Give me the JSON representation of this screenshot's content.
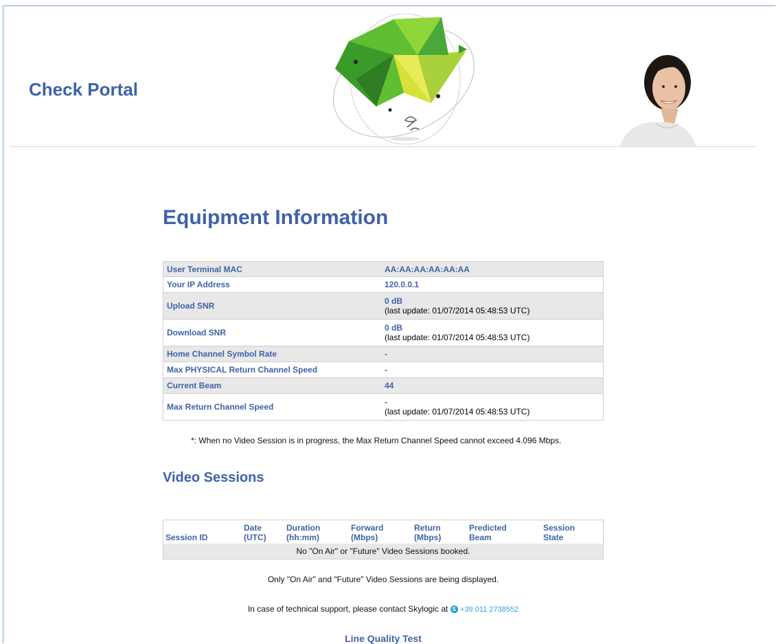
{
  "header": {
    "brand": "Check Portal",
    "logo_icon": "satellite-sphere-logo",
    "photo": "smiling-woman-photo"
  },
  "equipment": {
    "title": "Equipment Information",
    "rows": [
      {
        "label": "User Terminal MAC",
        "value": "AA:AA:AA:AA:AA:AA",
        "note": ""
      },
      {
        "label": "Your IP Address",
        "value": "120.0.0.1",
        "note": ""
      },
      {
        "label": "Upload SNR",
        "value": "0 dB",
        "note": "(last update: 01/07/2014 05:48:53 UTC)"
      },
      {
        "label": "Download SNR",
        "value": "0 dB",
        "note": "(last update: 01/07/2014 05:48:53 UTC)"
      },
      {
        "label": "Home Channel Symbol Rate",
        "value": "-",
        "note": ""
      },
      {
        "label": "Max PHYSICAL Return Channel Speed",
        "value": "-",
        "note": ""
      },
      {
        "label": "Current Beam",
        "value": "44",
        "note": ""
      },
      {
        "label": "Max Return Channel Speed",
        "value": "-",
        "note": "(last update: 01/07/2014 05:48:53 UTC)"
      }
    ],
    "footnote": "*: When no Video Session is in progress, the Max Return Channel Speed cannot exceed 4.096 Mbps."
  },
  "video": {
    "title": "Video Sessions",
    "columns": [
      {
        "line1": "",
        "line2": "Session ID"
      },
      {
        "line1": "Date",
        "line2": "(UTC)"
      },
      {
        "line1": "Duration",
        "line2": "(hh:mm)"
      },
      {
        "line1": "Forward",
        "line2": "(Mbps)"
      },
      {
        "line1": "Return",
        "line2": "(Mbps)"
      },
      {
        "line1": "Predicted",
        "line2": "Beam"
      },
      {
        "line1": "Session",
        "line2": "State"
      }
    ],
    "empty_message": "No \"On Air\" or \"Future\" Video Sessions booked.",
    "display_note": "Only \"On Air\" and \"Future\" Video Sessions are being displayed."
  },
  "support": {
    "text": "In case of technical support, please contact Skylogic at",
    "icon": "skype-icon",
    "phone": "+39 011 2738552"
  },
  "line_quality": "Line Quality Test"
}
